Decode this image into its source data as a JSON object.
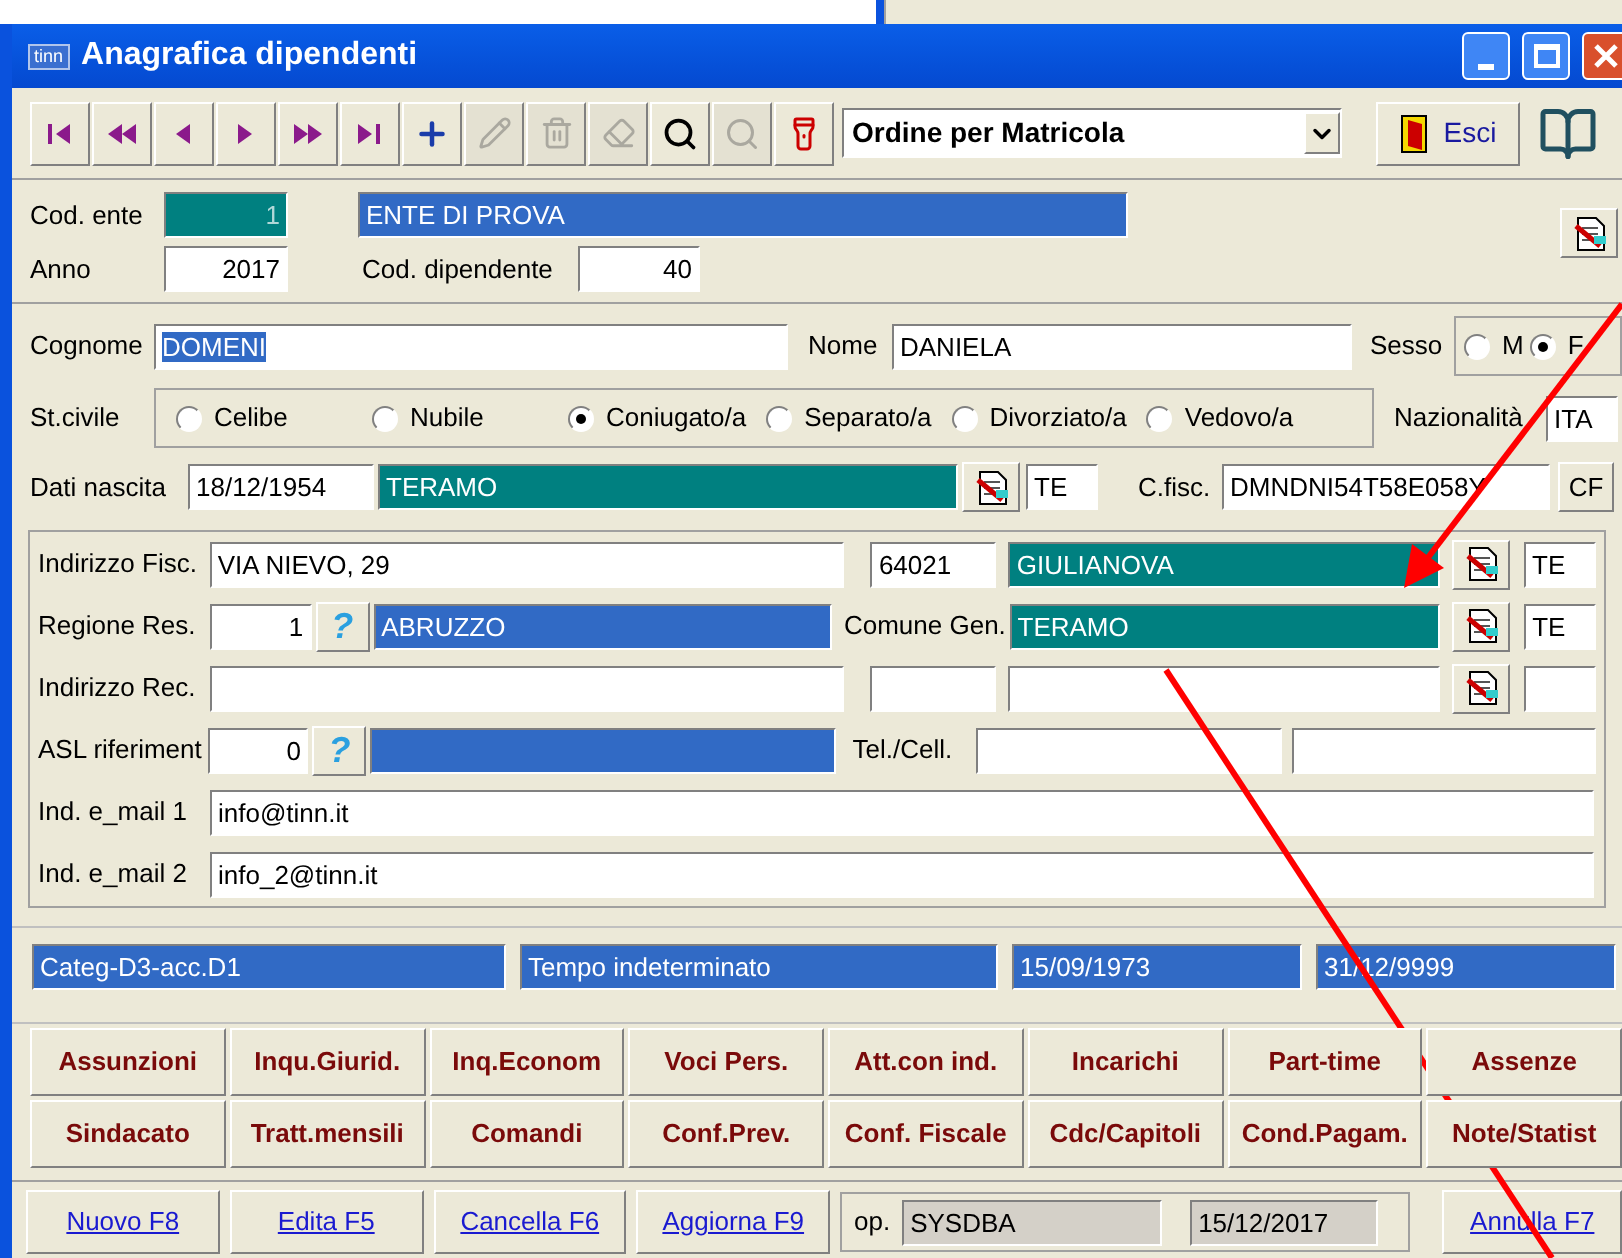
{
  "window": {
    "title": "Anagrafica dipendenti",
    "app_badge": "tinn"
  },
  "toolbar": {
    "buttons": [
      {
        "kind": "first",
        "disabled": false
      },
      {
        "kind": "fastback",
        "disabled": false
      },
      {
        "kind": "prev",
        "disabled": false
      },
      {
        "kind": "next",
        "disabled": false
      },
      {
        "kind": "fastforward",
        "disabled": false
      },
      {
        "kind": "last",
        "disabled": false
      },
      {
        "kind": "add",
        "disabled": false
      },
      {
        "kind": "edit",
        "disabled": true
      },
      {
        "kind": "remove",
        "disabled": true
      },
      {
        "kind": "erase",
        "disabled": true
      },
      {
        "kind": "search",
        "disabled": false
      },
      {
        "kind": "searchmore",
        "disabled": true
      },
      {
        "kind": "torch",
        "disabled": false
      }
    ],
    "order": "Ordine per Matricola",
    "exit": "Esci"
  },
  "header": {
    "cod_ente_label": "Cod. ente",
    "cod_ente": "1",
    "ente_name": "ENTE DI PROVA",
    "anno_label": "Anno",
    "anno": "2017",
    "cod_dip_label": "Cod. dipendente",
    "cod_dip": "40"
  },
  "person": {
    "cognome_label": "Cognome",
    "cognome": "DOMENI",
    "nome_label": "Nome",
    "nome": "DANIELA",
    "sesso_label": "Sesso",
    "sesso": [
      {
        "label": "M",
        "selected": false
      },
      {
        "label": "F",
        "selected": true
      }
    ],
    "stato_civile_label": "St.civile",
    "stato_civile": [
      {
        "label": "Celibe",
        "selected": false
      },
      {
        "label": "Nubile",
        "selected": false
      },
      {
        "label": "Coniugato/a",
        "selected": true
      },
      {
        "label": "Separato/a",
        "selected": false
      },
      {
        "label": "Divorziato/a",
        "selected": false
      },
      {
        "label": "Vedovo/a",
        "selected": false
      }
    ],
    "nazionalita_label": "Nazionalità",
    "nazionalita": "ITA",
    "nascita_label": "Dati nascita",
    "nascita_data": "18/12/1954",
    "nascita_comune": "TERAMO",
    "nascita_prov": "TE",
    "cf_label": "C.fisc.",
    "cf": "DMNDNI54T58E058Y",
    "cf_button": "CF"
  },
  "address": {
    "fisc_label": "Indirizzo Fisc.",
    "fisc": "VIA NIEVO, 29",
    "cap": "64021",
    "comune": "GIULIANOVA",
    "prov": "TE",
    "regione_label": "Regione Res.",
    "regione_code": "1",
    "regione_help": "?",
    "regione": "ABRUZZO",
    "comune_gen_label": "Comune Gen.",
    "comune_gen": "TERAMO",
    "comune_gen_prov": "TE",
    "rec_label": "Indirizzo Rec.",
    "asl_label": "ASL riferiment",
    "asl_code": "0",
    "asl_help": "?",
    "tel_label": "Tel./Cell.",
    "email1_label": "Ind. e_mail 1",
    "email1": "info@tinn.it",
    "email2_label": "Ind. e_mail 2",
    "email2": "info_2@tinn.it"
  },
  "contract": [
    "Categ-D3-acc.D1",
    "Tempo indeterminato",
    "15/09/1973",
    "31/12/9999"
  ],
  "sections": [
    [
      "Assunzioni",
      "Inqu.Giurid.",
      "Inq.Econom",
      "Voci Pers.",
      "Att.con ind.",
      "Incarichi",
      "Part-time",
      "Assenze"
    ],
    [
      "Sindacato",
      "Tratt.mensili",
      "Comandi",
      "Conf.Prev.",
      "Conf. Fiscale",
      "Cdc/Capitoli",
      "Cond.Pagam.",
      "Note/Statist"
    ]
  ],
  "footer": {
    "actions": [
      "Nuovo F8",
      "Edita F5",
      "Cancella F6",
      "Aggiorna F9"
    ],
    "op_label": "op.",
    "operator": "SYSDBA",
    "date": "15/12/2017",
    "cancel": "Annulla F7"
  }
}
